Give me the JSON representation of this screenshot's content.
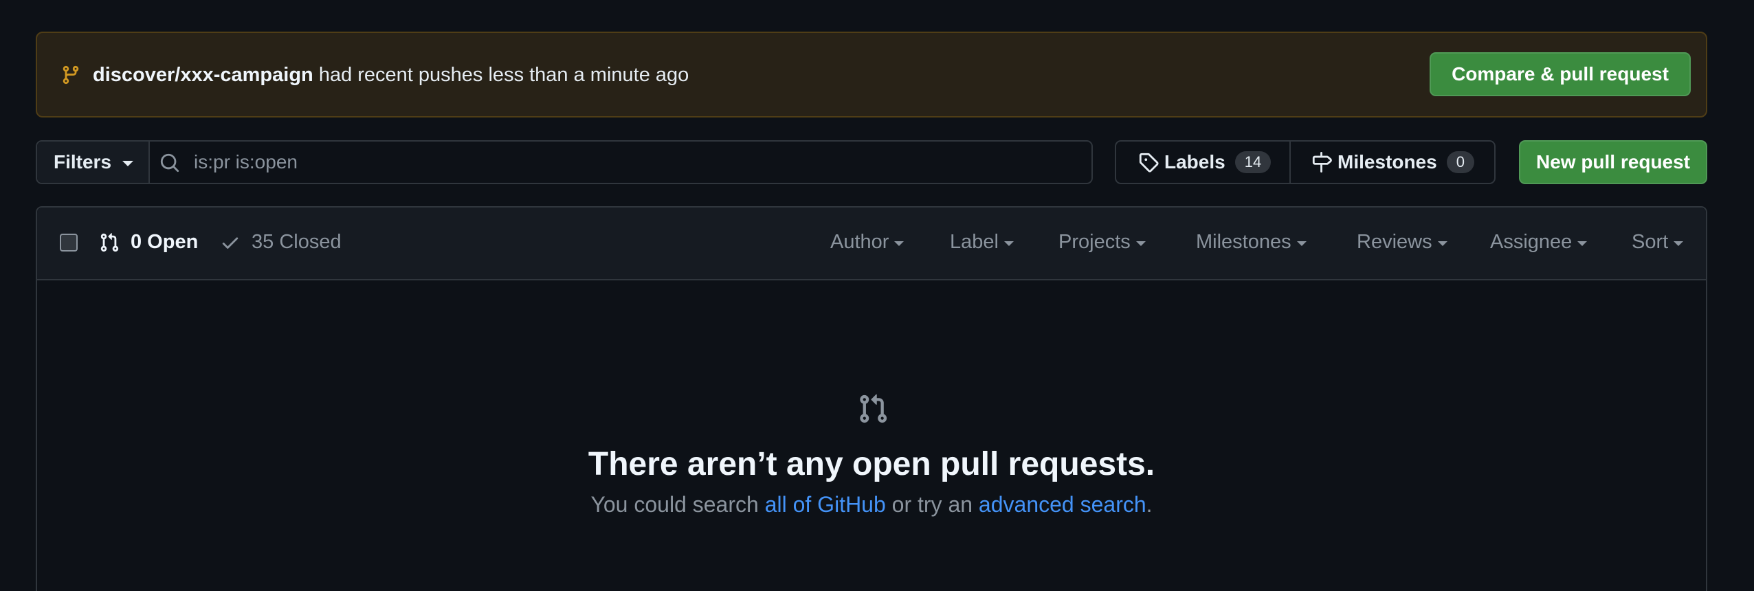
{
  "banner": {
    "branch": "discover/xxx-campaign",
    "message": " had recent pushes less than a minute ago",
    "compare_label": "Compare & pull request"
  },
  "filters": {
    "button_label": "Filters",
    "search_placeholder": "is:pr is:open"
  },
  "labels": {
    "label": "Labels",
    "count": "14"
  },
  "milestones": {
    "label": "Milestones",
    "count": "0"
  },
  "new_pr_label": "New pull request",
  "list_header": {
    "open_label": "0 Open",
    "closed_label": "35 Closed",
    "filters": [
      "Author",
      "Label",
      "Projects",
      "Milestones",
      "Reviews",
      "Assignee",
      "Sort"
    ]
  },
  "blankslate": {
    "title": "There aren’t any open pull requests.",
    "sub_prefix": "You could search ",
    "link1": "all of GitHub",
    "sub_middle": " or try an ",
    "link2": "advanced search",
    "sub_suffix": "."
  },
  "colors": {
    "background": "#0d1117",
    "green": "#3b8c3f",
    "link": "#4493f8",
    "banner_bg": "#282217",
    "banner_icon": "#d29922"
  }
}
